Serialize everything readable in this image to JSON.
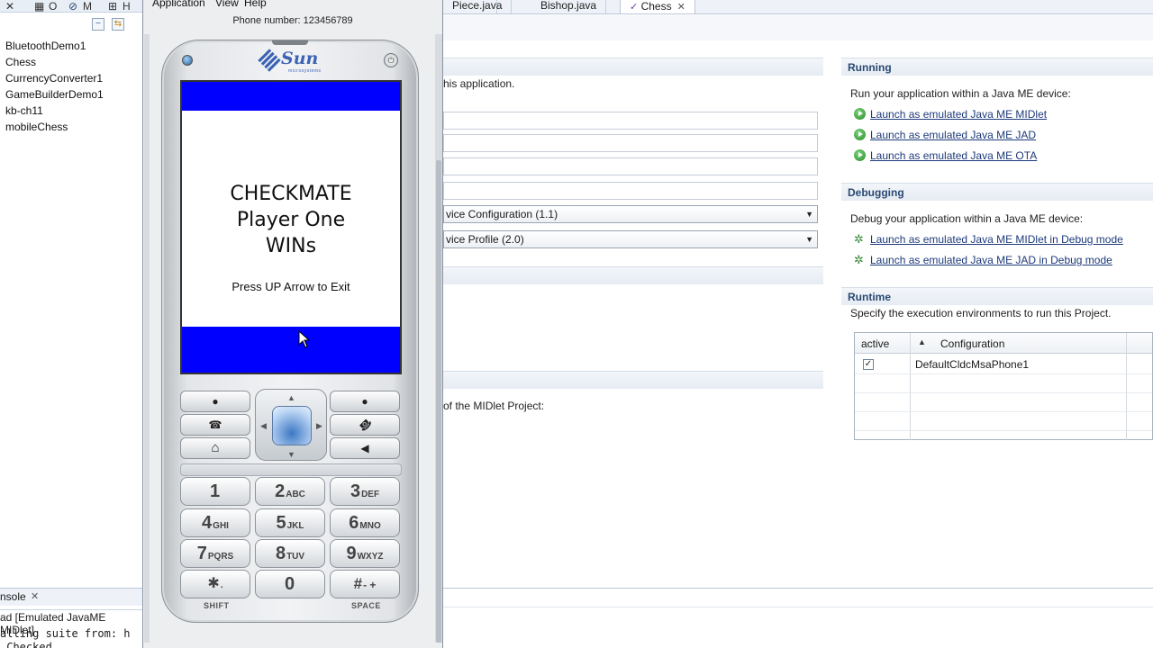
{
  "eclipse": {
    "left_toolbar": {
      "o_label": "O",
      "m_label": "M",
      "h_label": "H"
    },
    "projects": [
      "BluetoothDemo1",
      "Chess",
      "CurrencyConverter1",
      "GameBuilderDemo1",
      "kb-ch11",
      "mobileChess"
    ],
    "editor_tabs": [
      {
        "label": "Piece.java"
      },
      {
        "label": "Bishop.java"
      },
      {
        "label": "Chess",
        "close": "✕"
      }
    ],
    "overview": {
      "intro_fragment": "his application.",
      "config_combo": "vice Configuration (1.1)",
      "profile_combo": "vice Profile (2.0)",
      "midlet_fragment": "of the MIDlet Project:"
    },
    "running": {
      "title": "Running",
      "desc": "Run your application within a Java ME device:",
      "links": [
        "Launch as emulated Java ME MIDlet",
        "Launch as emulated Java ME JAD",
        "Launch as emulated Java ME OTA"
      ]
    },
    "debugging": {
      "title": "Debugging",
      "desc": "Debug your application within a Java ME device:",
      "links": [
        "Launch as emulated Java ME MIDlet in Debug mode",
        "Launch as emulated Java ME JAD in Debug mode"
      ]
    },
    "runtime": {
      "title": "Runtime",
      "desc": "Specify the execution environments to run this Project.",
      "col_active": "active",
      "col_configuration": "Configuration",
      "sort_glyph": "▲",
      "rows": [
        {
          "checked": true,
          "configuration": "DefaultCldcMsaPhone1"
        }
      ]
    },
    "console": {
      "tab_label": "nsole",
      "tab_close": "✕",
      "line1": "ad [Emulated JavaME MIDlet]",
      "line2": "alling suite from: h",
      "line3": " Checked"
    }
  },
  "emulator": {
    "menu": [
      "Application",
      "View",
      "Help"
    ],
    "phone_number": "Phone number:  123456789",
    "brand": "Sun",
    "brand_sub": "microsystems",
    "screen": {
      "message_line1": "CHECKMATE",
      "message_line2": "Player One",
      "message_line3": "WINs",
      "instruction": "Press UP Arrow to Exit",
      "bar_color": "#0000ff"
    },
    "keypad": [
      {
        "num": "1",
        "letters": ""
      },
      {
        "num": "2",
        "letters": "ABC"
      },
      {
        "num": "3",
        "letters": "DEF"
      },
      {
        "num": "4",
        "letters": "GHI"
      },
      {
        "num": "5",
        "letters": "JKL"
      },
      {
        "num": "6",
        "letters": "MNO"
      },
      {
        "num": "7",
        "letters": "PQRS"
      },
      {
        "num": "8",
        "letters": "TUV"
      },
      {
        "num": "9",
        "letters": "WXYZ"
      },
      {
        "num": "✱",
        "letters": "."
      },
      {
        "num": "0",
        "letters": ""
      },
      {
        "num": "#",
        "letters": "- +"
      }
    ],
    "labels": {
      "shift": "SHIFT",
      "space": "SPACE"
    },
    "icons": {
      "call": "☎",
      "end": "☎",
      "home": "⌂",
      "back": "◀",
      "dot": "●"
    }
  }
}
